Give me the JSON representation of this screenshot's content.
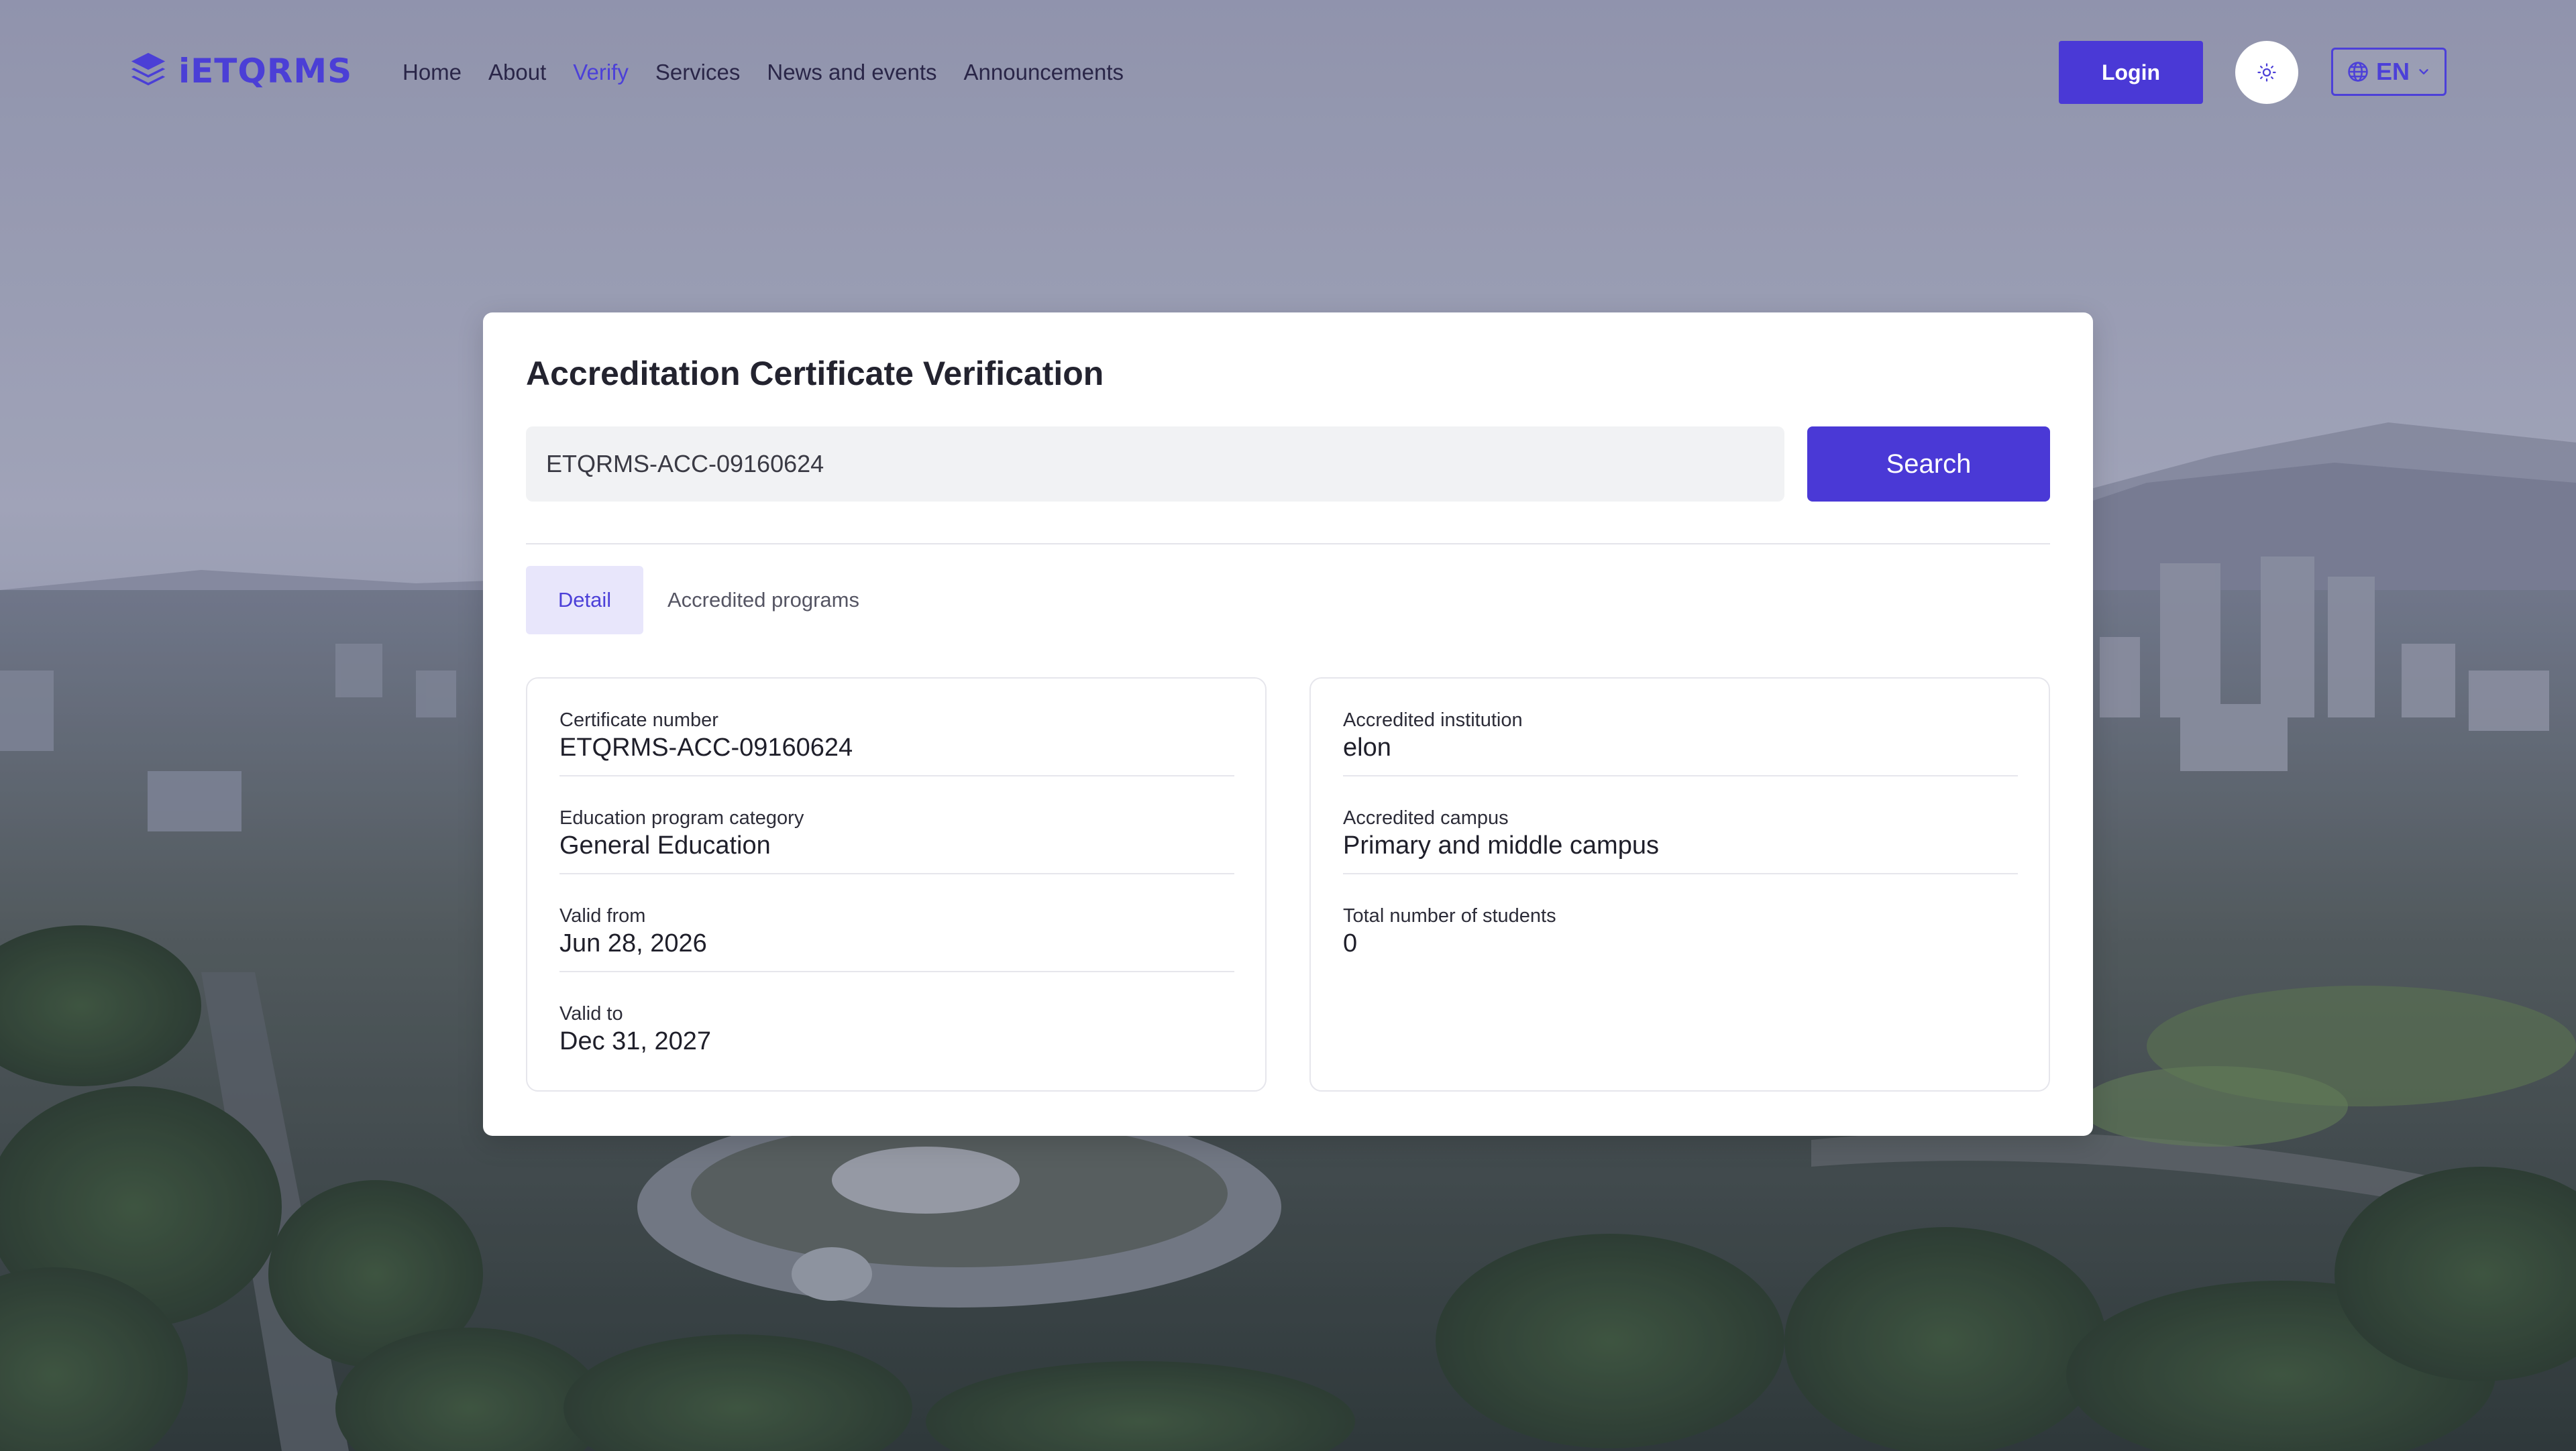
{
  "header": {
    "logo_text": "iETQRMS",
    "nav": [
      {
        "label": "Home",
        "active": false
      },
      {
        "label": "About",
        "active": false
      },
      {
        "label": "Verify",
        "active": true
      },
      {
        "label": "Services",
        "active": false
      },
      {
        "label": "News and events",
        "active": false
      },
      {
        "label": "Announcements",
        "active": false
      }
    ],
    "login_label": "Login",
    "theme_icon": "sun-icon",
    "language": {
      "label": "EN",
      "icon": "globe-icon",
      "chevron": "chevron-down-icon"
    }
  },
  "card": {
    "title": "Accreditation Certificate Verification",
    "search": {
      "value": "ETQRMS-ACC-09160624",
      "button_label": "Search"
    },
    "tabs": [
      {
        "label": "Detail",
        "active": true
      },
      {
        "label": "Accredited programs",
        "active": false
      }
    ],
    "left_panel": [
      {
        "label": "Certificate number",
        "value": "ETQRMS-ACC-09160624"
      },
      {
        "label": "Education program category",
        "value": "General Education"
      },
      {
        "label": "Valid from",
        "value": "Jun 28, 2026"
      },
      {
        "label": "Valid to",
        "value": "Dec 31, 2027"
      }
    ],
    "right_panel": [
      {
        "label": "Accredited institution",
        "value": "elon"
      },
      {
        "label": "Accredited campus",
        "value": "Primary and middle campus"
      },
      {
        "label": "Total number of students",
        "value": "0"
      }
    ]
  },
  "colors": {
    "accent": "#4A39D6",
    "accent_text": "#4C40D8",
    "tab_active_bg": "#E8E6FB",
    "input_bg": "#F1F2F4",
    "card_bg": "#FFFFFF"
  }
}
